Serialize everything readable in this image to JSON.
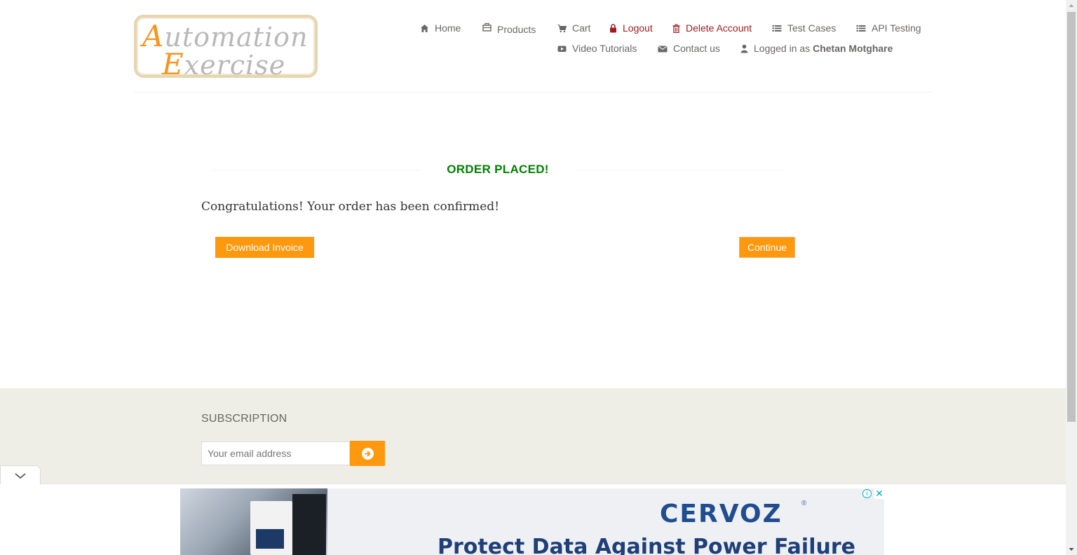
{
  "logo": {
    "line1_cap": "A",
    "line1_rest": "utomation",
    "line2_cap": "E",
    "line2_rest": "xercise"
  },
  "nav": {
    "home": {
      "label": "Home",
      "icon": "home-icon"
    },
    "products": {
      "label": "Products",
      "icon": "products-icon"
    },
    "cart": {
      "label": "Cart",
      "icon": "cart-icon"
    },
    "logout": {
      "label": "Logout",
      "icon": "lock-icon"
    },
    "delete_account": {
      "label": "Delete Account",
      "icon": "trash-icon"
    },
    "test_cases": {
      "label": "Test Cases",
      "icon": "list-icon"
    },
    "api_testing": {
      "label": "API Testing",
      "icon": "list-icon"
    },
    "video_tutorials": {
      "label": "Video Tutorials",
      "icon": "youtube-play-icon"
    },
    "contact_us": {
      "label": "Contact us",
      "icon": "envelope-icon"
    },
    "logged_in_prefix": "Logged in as",
    "logged_in_user": "Chetan Motghare"
  },
  "order": {
    "title": "ORDER PLACED!",
    "message": "Congratulations! Your order has been confirmed!",
    "download_label": "Download Invoice",
    "continue_label": "Continue"
  },
  "footer": {
    "subscription_title": "SUBSCRIPTION",
    "email_placeholder": "Your email address"
  },
  "ad": {
    "brand": "CERVOZ",
    "headline": "Protect Data Against Power Failure",
    "info": "ⓘ",
    "close": "✕"
  },
  "colors": {
    "accent": "#fe980f",
    "success": "#008000",
    "danger_link": "#a21c1c",
    "footer_bg": "#eeeee7",
    "text": "#696763"
  }
}
